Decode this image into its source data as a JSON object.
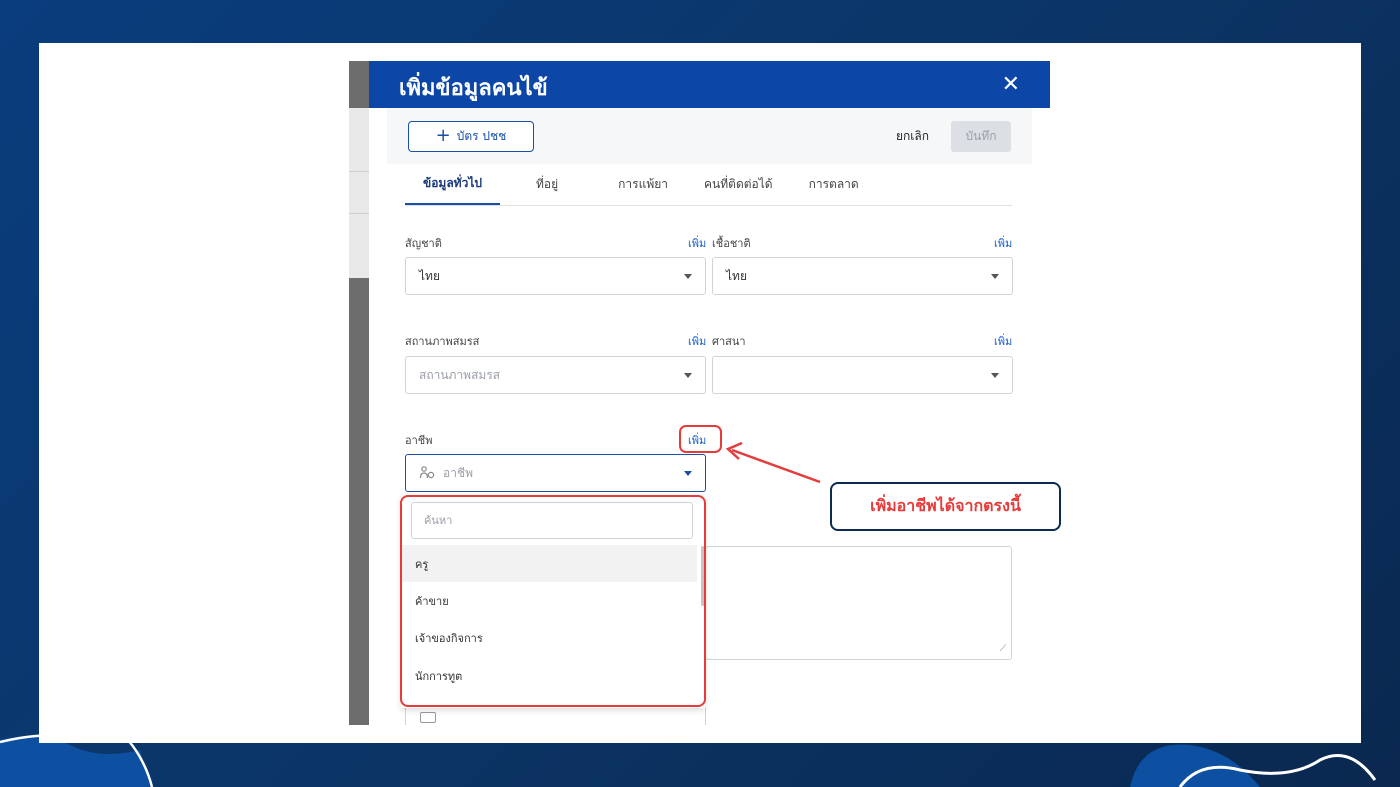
{
  "modal": {
    "title": "เพิ่มข้อมูลคนไข้",
    "close_glyph": "✕"
  },
  "toolbar": {
    "id_card_label": "บัตร ปชช",
    "plus_glyph": "+",
    "cancel_label": "ยกเลิก",
    "save_label": "บันทึก"
  },
  "tabs": [
    {
      "label": "ข้อมูลทั่วไป",
      "active": true
    },
    {
      "label": "ที่อยู่",
      "active": false
    },
    {
      "label": "การแพ้ยา",
      "active": false
    },
    {
      "label": "คนที่ติดต่อได้",
      "active": false
    },
    {
      "label": "การตลาด",
      "active": false
    }
  ],
  "fields": {
    "nationality": {
      "label": "สัญชาติ",
      "add": "เพิ่ม",
      "value": "ไทย"
    },
    "ethnicity": {
      "label": "เชื้อชาติ",
      "add": "เพิ่ม",
      "value": "ไทย"
    },
    "marital": {
      "label": "สถานภาพสมรส",
      "add": "เพิ่ม",
      "placeholder": "สถานภาพสมรส"
    },
    "religion": {
      "label": "ศาสนา",
      "add": "เพิ่ม",
      "value": ""
    },
    "occupation": {
      "label": "อาชีพ",
      "add": "เพิ่ม",
      "placeholder": "อาชีพ"
    }
  },
  "dropdown": {
    "search_placeholder": "ค้นหา",
    "items": [
      "ครู",
      "ค้าขาย",
      "เจ้าของกิจการ",
      "นักการทูต"
    ]
  },
  "annotation": {
    "callout_text": "เพิ่มอาชีพได้จากตรงนี้"
  },
  "colors": {
    "primary": "#0c47a8",
    "highlight": "#e53b3b",
    "callout_border": "#0c2a52"
  }
}
